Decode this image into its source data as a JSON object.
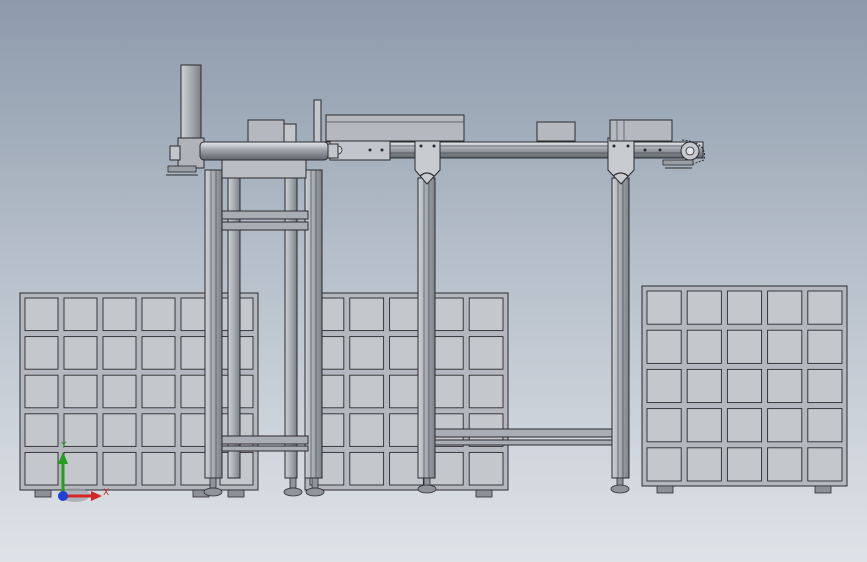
{
  "view": {
    "background_top": "#8d9aab",
    "background_bottom": "#dfe3e8",
    "part_color": "#b9bcc2",
    "edge_color": "#2b2b2e"
  },
  "triad": {
    "x_label": "X",
    "y_label": "Y",
    "x_color": "#d42626",
    "y_color": "#1fa01f",
    "z_color": "#1f3fd6"
  },
  "pallet_grid": {
    "rows": 5,
    "cols": 6
  }
}
